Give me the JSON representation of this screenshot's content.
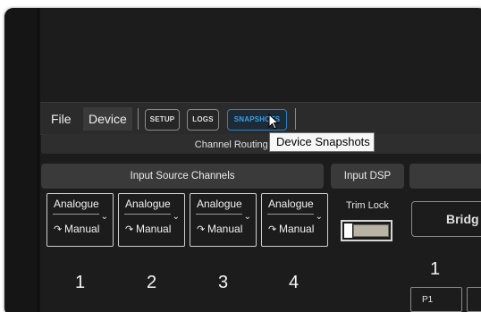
{
  "menubar": {
    "file_label": "File",
    "device_label": "Device",
    "setup_label": "SETUP",
    "logs_label": "LOGS",
    "snapshots_label": "SNAPSHOTS"
  },
  "tooltip": {
    "text": "Device Snapshots"
  },
  "section": {
    "title": "Channel Routing Configuration"
  },
  "headers": {
    "input_source": "Input Source Channels",
    "input_dsp": "Input DSP"
  },
  "channels": [
    {
      "source": "Analogue",
      "mode": "Manual",
      "number": "1"
    },
    {
      "source": "Analogue",
      "mode": "Manual",
      "number": "2"
    },
    {
      "source": "Analogue",
      "mode": "Manual",
      "number": "3"
    },
    {
      "source": "Analogue",
      "mode": "Manual",
      "number": "4"
    }
  ],
  "dsp": {
    "trim_lock_label": "Trim Lock",
    "trim_lock_on": false
  },
  "bridge": {
    "label": "Bridg",
    "number": "1",
    "p1_label": "P1"
  },
  "colors": {
    "accent": "#2b83c6",
    "background": "#1c1c1c"
  }
}
